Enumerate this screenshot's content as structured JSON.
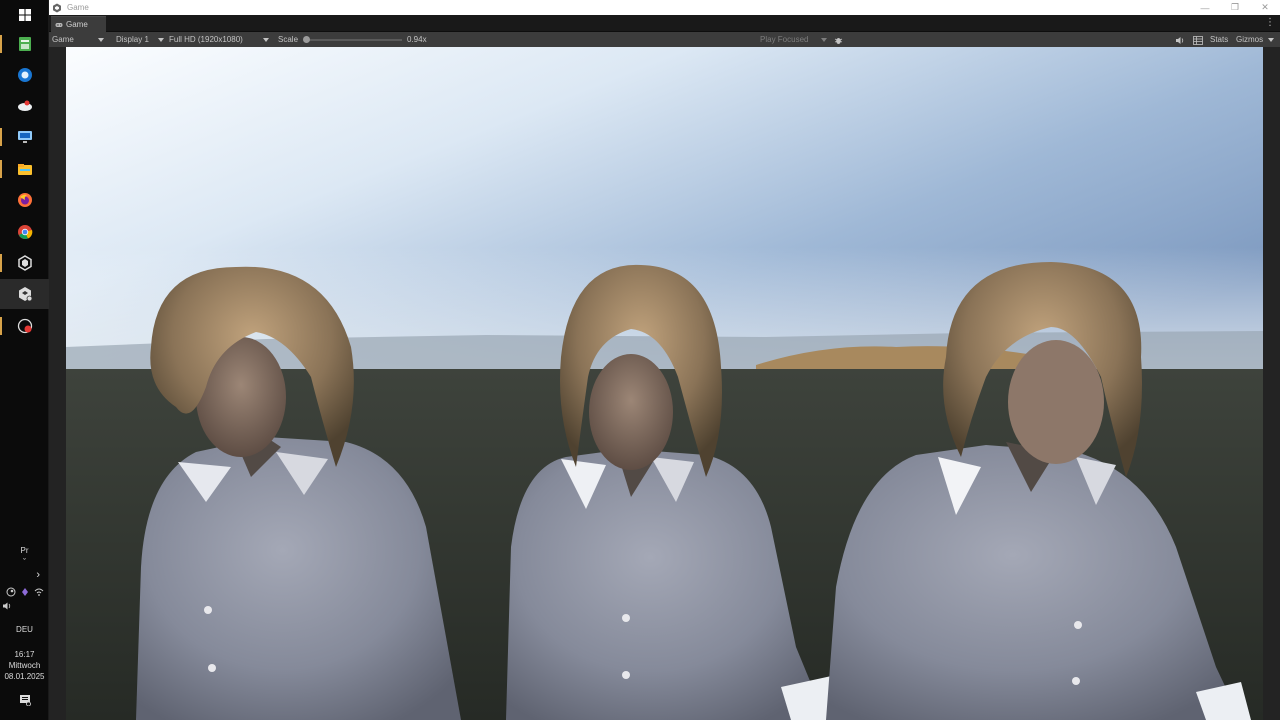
{
  "window": {
    "title": "Game",
    "controls": {
      "minimize": "—",
      "restore": "❐",
      "close": "✕"
    }
  },
  "tab": {
    "label": "Game",
    "menu_glyph": "⋮"
  },
  "toolbar": {
    "view_mode": "Game",
    "display": "Display 1",
    "resolution": "Full HD (1920x1080)",
    "scale_label": "Scale",
    "scale_value": "0.94x",
    "play_mode": "Play Focused",
    "stats": "Stats",
    "gizmos": "Gizmos",
    "scale_fraction": 0.02
  },
  "taskbar": {
    "pinned": [
      "windows-start-icon",
      "spreadsheet-app-icon",
      "blue-app-icon",
      "cloud-app-icon",
      "monitor-app-icon",
      "file-explorer-icon",
      "firefox-icon",
      "chrome-icon",
      "unity-hub-icon",
      "unity-editor-icon",
      "recorder-icon"
    ],
    "tray_label": "Pr",
    "language": "DEU",
    "time": "16:17",
    "weekday": "Mittwoch",
    "date": "08.01.2025"
  },
  "colors": {
    "unity_toolbar": "#3c3c3c",
    "accent_pin": "#d8a34a",
    "shirt": "#8e93a3",
    "hair": "#8a7357"
  }
}
